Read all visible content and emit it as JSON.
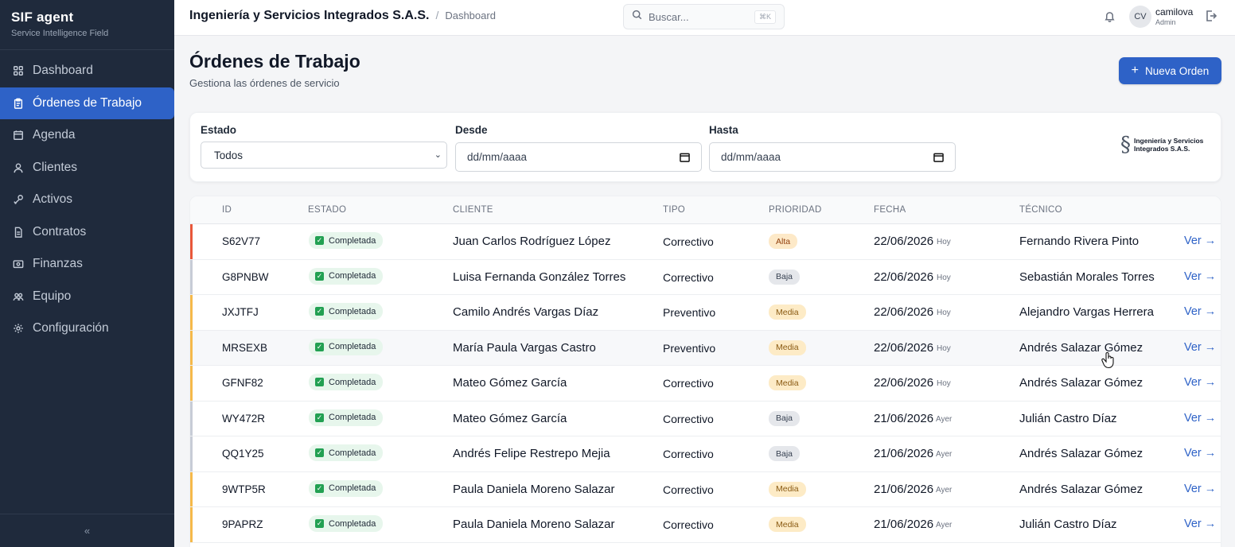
{
  "sidebar": {
    "brand_title": "SIF agent",
    "brand_sub": "Service Intelligence Field",
    "items": [
      {
        "label": "Dashboard",
        "icon": "grid-icon",
        "active": false
      },
      {
        "label": "Órdenes de Trabajo",
        "icon": "clipboard-icon",
        "active": true
      },
      {
        "label": "Agenda",
        "icon": "calendar-icon",
        "active": false
      },
      {
        "label": "Clientes",
        "icon": "users-icon",
        "active": false
      },
      {
        "label": "Activos",
        "icon": "wrench-icon",
        "active": false
      },
      {
        "label": "Contratos",
        "icon": "document-icon",
        "active": false
      },
      {
        "label": "Finanzas",
        "icon": "wallet-icon",
        "active": false
      },
      {
        "label": "Equipo",
        "icon": "team-icon",
        "active": false
      },
      {
        "label": "Configuración",
        "icon": "gear-icon",
        "active": false
      }
    ],
    "collapse_label": "«"
  },
  "topbar": {
    "company": "Ingeniería y Servicios Integrados S.A.S.",
    "separator": "/",
    "page": "Dashboard",
    "search_placeholder": "Buscar...",
    "search_shortcut": "⌘K",
    "user_initials": "CV",
    "user_name": "camilova",
    "user_role": "Admin"
  },
  "page": {
    "title": "Órdenes de Trabajo",
    "subtitle": "Gestiona las órdenes de servicio",
    "new_button": "Nueva Orden"
  },
  "filters": {
    "estado_label": "Estado",
    "estado_value": "Todos",
    "desde_label": "Desde",
    "desde_placeholder": "dd/mm/aaaa",
    "hasta_label": "Hasta",
    "hasta_placeholder": "dd/mm/aaaa",
    "logo_line1": "Ingeniería y Servicios",
    "logo_line2": "Integrados S.A.S."
  },
  "table": {
    "headers": [
      "ID",
      "ESTADO",
      "CLIENTE",
      "TIPO",
      "PRIORIDAD",
      "FECHA",
      "TÉCNICO"
    ],
    "action_label": "Ver →",
    "rows": [
      {
        "id": "S62V77",
        "status": "Completada",
        "client": "Juan Carlos Rodríguez López",
        "type": "Correctivo",
        "priority": "Alta",
        "date": "22/06/2026",
        "rel": "Hoy",
        "tech": "Fernando Rivera Pinto"
      },
      {
        "id": "G8PNBW",
        "status": "Completada",
        "client": "Luisa Fernanda González Torres",
        "type": "Correctivo",
        "priority": "Baja",
        "date": "22/06/2026",
        "rel": "Hoy",
        "tech": "Sebastián Morales Torres"
      },
      {
        "id": "JXJTFJ",
        "status": "Completada",
        "client": "Camilo Andrés Vargas Díaz",
        "type": "Preventivo",
        "priority": "Media",
        "date": "22/06/2026",
        "rel": "Hoy",
        "tech": "Alejandro Vargas Herrera"
      },
      {
        "id": "MRSEXB",
        "status": "Completada",
        "client": "María Paula Vargas Castro",
        "type": "Preventivo",
        "priority": "Media",
        "date": "22/06/2026",
        "rel": "Hoy",
        "tech": "Andrés Salazar Gómez"
      },
      {
        "id": "GFNF82",
        "status": "Completada",
        "client": "Mateo Gómez García",
        "type": "Correctivo",
        "priority": "Media",
        "date": "22/06/2026",
        "rel": "Hoy",
        "tech": "Andrés Salazar Gómez"
      },
      {
        "id": "WY472R",
        "status": "Completada",
        "client": "Mateo Gómez García",
        "type": "Correctivo",
        "priority": "Baja",
        "date": "21/06/2026",
        "rel": "Ayer",
        "tech": "Julián Castro Díaz"
      },
      {
        "id": "QQ1Y25",
        "status": "Completada",
        "client": "Andrés Felipe Restrepo Mejia",
        "type": "Correctivo",
        "priority": "Baja",
        "date": "21/06/2026",
        "rel": "Ayer",
        "tech": "Andrés Salazar Gómez"
      },
      {
        "id": "9WTP5R",
        "status": "Completada",
        "client": "Paula Daniela Moreno Salazar",
        "type": "Correctivo",
        "priority": "Media",
        "date": "21/06/2026",
        "rel": "Ayer",
        "tech": "Andrés Salazar Gómez"
      },
      {
        "id": "9PAPRZ",
        "status": "Completada",
        "client": "Paula Daniela Moreno Salazar",
        "type": "Correctivo",
        "priority": "Media",
        "date": "21/06/2026",
        "rel": "Ayer",
        "tech": "Julián Castro Díaz"
      }
    ]
  },
  "colors": {
    "accent": "#2e62c7",
    "sidebar_bg": "#1f2a3c",
    "priority_alta": "#e8573a",
    "priority_media": "#f5b94a",
    "priority_baja": "#c7ccd6",
    "status_ok": "#22a052"
  }
}
